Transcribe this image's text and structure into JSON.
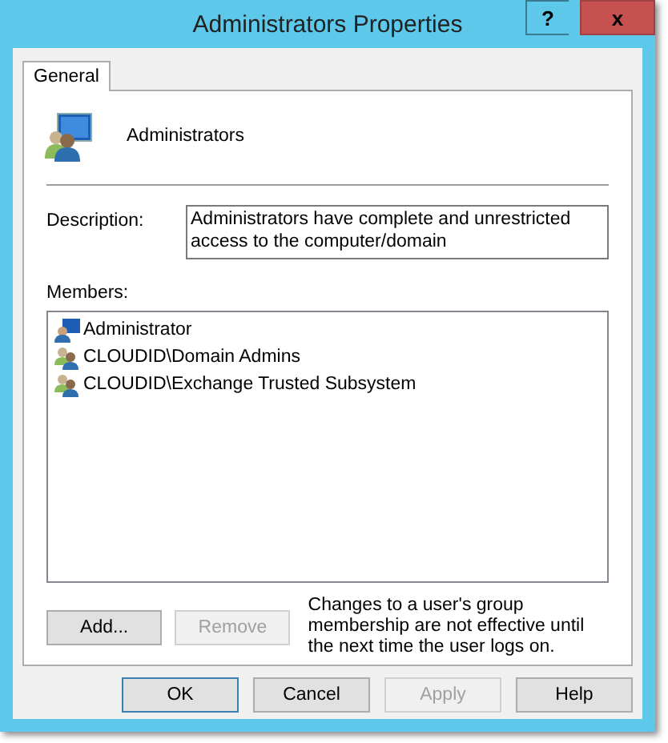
{
  "window": {
    "title": "Administrators Properties",
    "help_button": "?",
    "close_button": "x"
  },
  "tabs": [
    {
      "label": "General",
      "selected": true
    }
  ],
  "group_name": "Administrators",
  "description": {
    "label": "Description:",
    "value": "Administrators have complete and unrestricted access to the computer/domain"
  },
  "members": {
    "label": "Members:",
    "items": [
      {
        "name": "Administrator",
        "kind": "user"
      },
      {
        "name": "CLOUDID\\Domain Admins",
        "kind": "group"
      },
      {
        "name": "CLOUDID\\Exchange Trusted Subsystem",
        "kind": "group"
      }
    ]
  },
  "member_buttons": [
    {
      "label": "Add...",
      "disabled": false
    },
    {
      "label": "Remove",
      "disabled": true
    }
  ],
  "note": "Changes to a user's group membership are not effective until the next time the user logs on.",
  "buttons": [
    {
      "label": "OK",
      "disabled": false,
      "default": true
    },
    {
      "label": "Cancel",
      "disabled": false,
      "default": false
    },
    {
      "label": "Apply",
      "disabled": true,
      "default": false
    },
    {
      "label": "Help",
      "disabled": false,
      "default": false
    }
  ]
}
